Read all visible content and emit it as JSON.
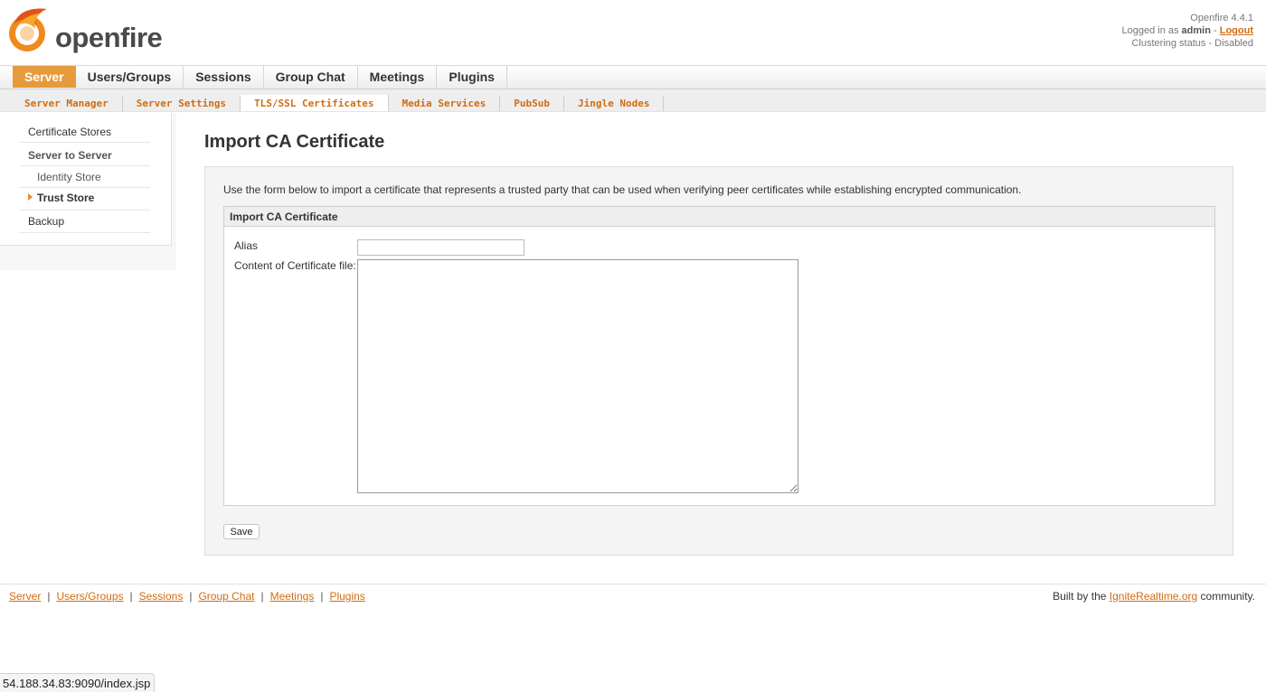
{
  "header": {
    "logo_text": "openfire",
    "version": "Openfire 4.4.1",
    "logged_in_prefix": "Logged in as",
    "username": "admin",
    "logout_label": "Logout",
    "clustering": "Clustering status - Disabled"
  },
  "tabs": [
    "Server",
    "Users/Groups",
    "Sessions",
    "Group Chat",
    "Meetings",
    "Plugins"
  ],
  "active_tab": "Server",
  "subtabs": [
    "Server Manager",
    "Server Settings",
    "TLS/SSL Certificates",
    "Media Services",
    "PubSub",
    "Jingle Nodes"
  ],
  "active_subtab": "TLS/SSL Certificates",
  "sidebar": {
    "items": [
      {
        "label": "Certificate Stores"
      },
      {
        "label": "Server to Server"
      },
      {
        "label": "Identity Store"
      },
      {
        "label": "Trust Store"
      },
      {
        "label": "Backup"
      }
    ]
  },
  "main": {
    "title": "Import CA Certificate",
    "intro": "Use the form below to import a certificate that represents a trusted party that can be used when verifying peer certificates while establishing encrypted communication.",
    "section_title": "Import CA Certificate",
    "alias_label": "Alias",
    "alias_value": "",
    "content_label": "Content of Certificate file:",
    "content_value": "",
    "save_label": "Save"
  },
  "footer": {
    "links": [
      "Server",
      "Users/Groups",
      "Sessions",
      "Group Chat",
      "Meetings",
      "Plugins"
    ],
    "separator": "|",
    "credit_prefix": "Built by the",
    "credit_link": "IgniteRealtime.org",
    "credit_suffix": "community."
  },
  "status_url": "54.188.34.83:9090/index.jsp",
  "colors": {
    "accent": "#e79a3c",
    "link": "#d06c12"
  }
}
